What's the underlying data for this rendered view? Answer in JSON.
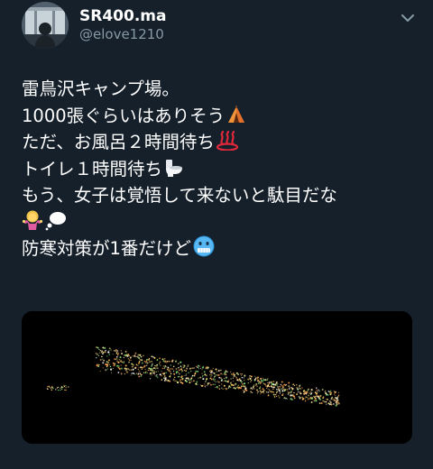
{
  "tweet": {
    "display_name": "SR400.ma",
    "handle": "@elove1210",
    "lines": [
      "雷鳥沢キャンプ場。",
      "1000張ぐらいはありそう",
      "ただ、お風呂２時間待ち",
      "トイレ１時間待ち",
      "もう、女子は覚悟して来ないと駄目だな",
      "",
      "防寒対策が1番だけど"
    ],
    "emoji_icons": {
      "line2": "tent-emoji",
      "line3": "hot-springs-emoji",
      "line4": "toilet-emoji",
      "line6": [
        "woman-shrugging-emoji",
        "thought-balloon-emoji"
      ],
      "line7": "cold-face-emoji"
    },
    "colors": {
      "background": "#15202b",
      "text": "#ffffff",
      "secondary_text": "#8899a6"
    }
  }
}
